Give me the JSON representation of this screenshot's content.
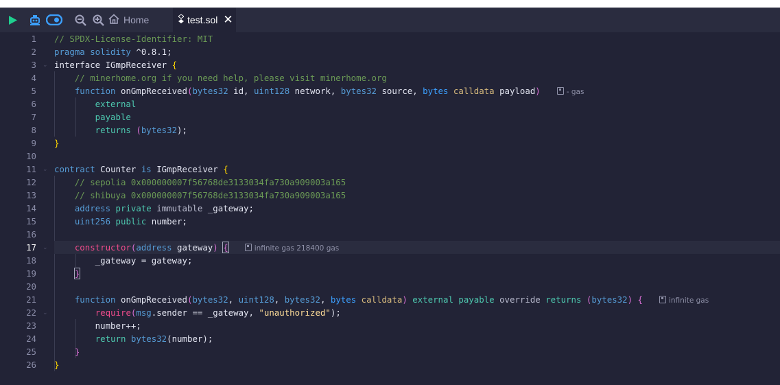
{
  "tabs": {
    "home_label": "Home",
    "file_label": "test.sol",
    "close_glyph": "✕"
  },
  "toolbar": {
    "icons": [
      "play-icon",
      "robot-icon",
      "toggle-icon",
      "zoom-out-icon",
      "zoom-in-icon",
      "home-icon",
      "file-icon"
    ]
  },
  "editor": {
    "active_line": 17,
    "line_numbers": [
      "1",
      "2",
      "3",
      "4",
      "5",
      "6",
      "7",
      "8",
      "9",
      "10",
      "11",
      "12",
      "13",
      "14",
      "15",
      "16",
      "17",
      "18",
      "19",
      "20",
      "21",
      "22",
      "23",
      "24",
      "25",
      "26"
    ],
    "gas_hints": {
      "line5": "- gas",
      "line17": "infinite gas 218400 gas",
      "line21": "infinite gas"
    },
    "lines": {
      "l1": "// SPDX-License-Identifier: MIT",
      "l2a": "pragma solidity",
      "l2b": " ^0.8.1;",
      "l3a": "interface",
      "l3b": " IGmpReceiver ",
      "l3c": "{",
      "l4": "    // minerhome.org if you need help, please visit minerhome.org",
      "l5a": "    ",
      "l5b": "function",
      "l5c": " onGmpReceived",
      "l5d": "(",
      "l5e": "bytes32",
      "l5f": " id, ",
      "l5g": "uint128",
      "l5h": " network, ",
      "l5i": "bytes32",
      "l5j": " source, ",
      "l5k": "bytes",
      "l5l": " calldata",
      "l5m": " payload",
      "l5n": ")",
      "l6": "        external",
      "l7": "        payable",
      "l8a": "        returns ",
      "l8b": "(",
      "l8c": "bytes32",
      "l8d": ");",
      "l9": "}",
      "l11a": "contract",
      "l11b": " Counter ",
      "l11c": "is",
      "l11d": " IGmpReceiver ",
      "l11e": "{",
      "l12": "    // sepolia 0x000000007f56768de3133034fa730a909003a165",
      "l13": "    // shibuya 0x000000007f56768de3133034fa730a909003a165",
      "l14a": "    ",
      "l14b": "address",
      "l14c": " private",
      "l14d": " immutable",
      "l14e": " _gateway;",
      "l15a": "    ",
      "l15b": "uint256",
      "l15c": " public",
      "l15d": " number;",
      "l17a": "    ",
      "l17b": "constructor",
      "l17c": "(",
      "l17d": "address",
      "l17e": " gateway",
      "l17f": ")",
      "l17g": " ",
      "l17h": "{",
      "l18": "        _gateway = gateway;",
      "l19a": "    ",
      "l19b": "}",
      "l21a": "    ",
      "l21b": "function",
      "l21c": " onGmpReceived",
      "l21d": "(",
      "l21e": "bytes32",
      "l21f": ", ",
      "l21g": "uint128",
      "l21h": ", ",
      "l21i": "bytes32",
      "l21j": ", ",
      "l21k": "bytes",
      "l21l": " calldata",
      "l21m": ")",
      "l21n": " external",
      "l21o": " payable",
      "l21p": " override",
      "l21q": " returns",
      "l21r": " (",
      "l21s": "bytes32",
      "l21t": ")",
      "l21u": " {",
      "l22a": "        ",
      "l22b": "require",
      "l22c": "(",
      "l22d": "msg",
      "l22e": ".sender == _gateway, ",
      "l22f": "\"unauthorized\"",
      "l22g": ");",
      "l23": "        number++;",
      "l24a": "        ",
      "l24b": "return",
      "l24c": " bytes32",
      "l24d": "(number);",
      "l25": "    }",
      "l26": "}"
    }
  },
  "colors": {
    "background": "#222336",
    "tabbar": "#2a2c3f",
    "play_green": "#1fcf8f",
    "accent_blue": "#3ca0ff"
  }
}
